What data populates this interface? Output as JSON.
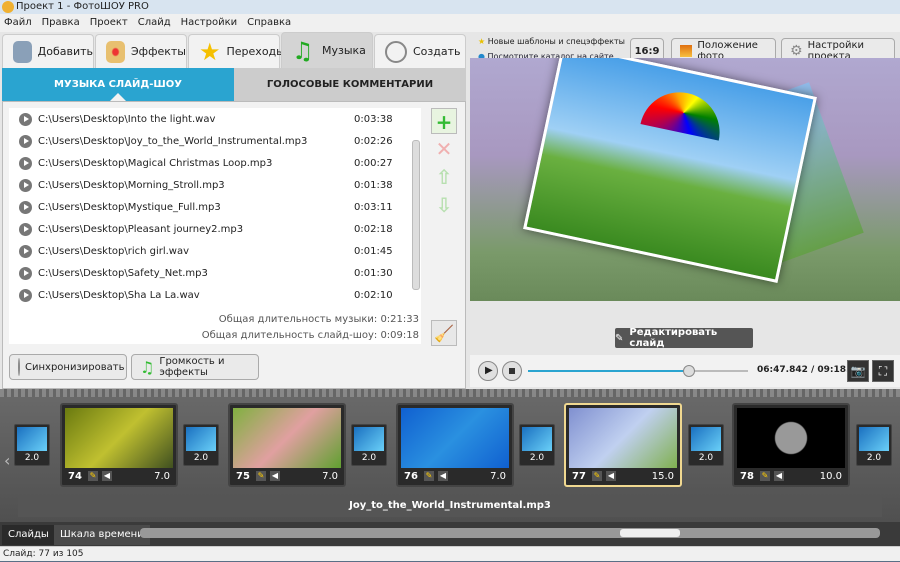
{
  "window": {
    "title": "Проект 1 - ФотоШОУ PRO"
  },
  "menu": [
    "Файл",
    "Правка",
    "Проект",
    "Слайд",
    "Настройки",
    "Справка"
  ],
  "tabs": [
    {
      "label": "Добавить",
      "icon": "camera-icon"
    },
    {
      "label": "Эффекты",
      "icon": "palette-icon"
    },
    {
      "label": "Переходы",
      "icon": "star-icon"
    },
    {
      "label": "Музыка",
      "icon": "music-note-icon",
      "active": true
    },
    {
      "label": "Создать",
      "icon": "film-reel-icon"
    }
  ],
  "subtabs": {
    "music": "МУЗЫКА СЛАЙД-ШОУ",
    "voice": "ГОЛОСОВЫЕ КОММЕНТАРИИ"
  },
  "tracks": [
    {
      "path": "C:\\Users\\Desktop\\Into the light.wav",
      "duration": "0:03:38"
    },
    {
      "path": "C:\\Users\\Desktop\\Joy_to_the_World_Instrumental.mp3",
      "duration": "0:02:26"
    },
    {
      "path": "C:\\Users\\Desktop\\Magical Christmas Loop.mp3",
      "duration": "0:00:27"
    },
    {
      "path": "C:\\Users\\Desktop\\Morning_Stroll.mp3",
      "duration": "0:01:38"
    },
    {
      "path": "C:\\Users\\Desktop\\Mystique_Full.mp3",
      "duration": "0:03:11"
    },
    {
      "path": "C:\\Users\\Desktop\\Pleasant journey2.mp3",
      "duration": "0:02:18"
    },
    {
      "path": "C:\\Users\\Desktop\\rich girl.wav",
      "duration": "0:01:45"
    },
    {
      "path": "C:\\Users\\Desktop\\Safety_Net.mp3",
      "duration": "0:01:30"
    },
    {
      "path": "C:\\Users\\Desktop\\Sha La La.wav",
      "duration": "0:02:10"
    }
  ],
  "totals": {
    "music": "Общая длительность музыки: 0:21:33",
    "slideshow": "Общая длительность слайд-шоу: 0:09:18"
  },
  "buttons": {
    "sync": "Синхронизировать",
    "volume": "Громкость и эффекты",
    "aspect": "16:9",
    "photo_pos": "Положение фото",
    "project_settings": "Настройки проекта",
    "edit_slide": "Редактировать слайд"
  },
  "promo": {
    "line1": "Новые шаблоны и спецэффекты",
    "link": "Посмотрите каталог на сайте..."
  },
  "player": {
    "time": "06:47.842 / 09:18.000",
    "progress": 0.731
  },
  "slides": [
    {
      "num": "74",
      "dur": "7.0",
      "bg": "linear-gradient(135deg,#6a7a10,#c0c030,#405020)"
    },
    {
      "num": "75",
      "dur": "7.0",
      "bg": "linear-gradient(135deg,#80b040,#e0a0a0,#60a030)"
    },
    {
      "num": "76",
      "dur": "7.0",
      "bg": "linear-gradient(135deg,#1060d0,#2a90e0,#1060d0)"
    },
    {
      "num": "77",
      "dur": "15.0",
      "bg": "linear-gradient(135deg,#8090d0,#c0d0f0,#80b050)",
      "selected": true
    },
    {
      "num": "78",
      "dur": "10.0",
      "bg": "radial-gradient(circle,#999 0 25%,#000 27%)"
    }
  ],
  "transitions": [
    "2.0",
    "2.0",
    "2.0",
    "2.0",
    "2.0",
    "2.0"
  ],
  "audio_track": "Joy_to_the_World_Instrumental.mp3",
  "bottom_tabs": [
    "Слайды",
    "Шкала времени"
  ],
  "status": "Слайд: 77 из 105",
  "colors": {
    "accent": "#2aa4d0"
  }
}
